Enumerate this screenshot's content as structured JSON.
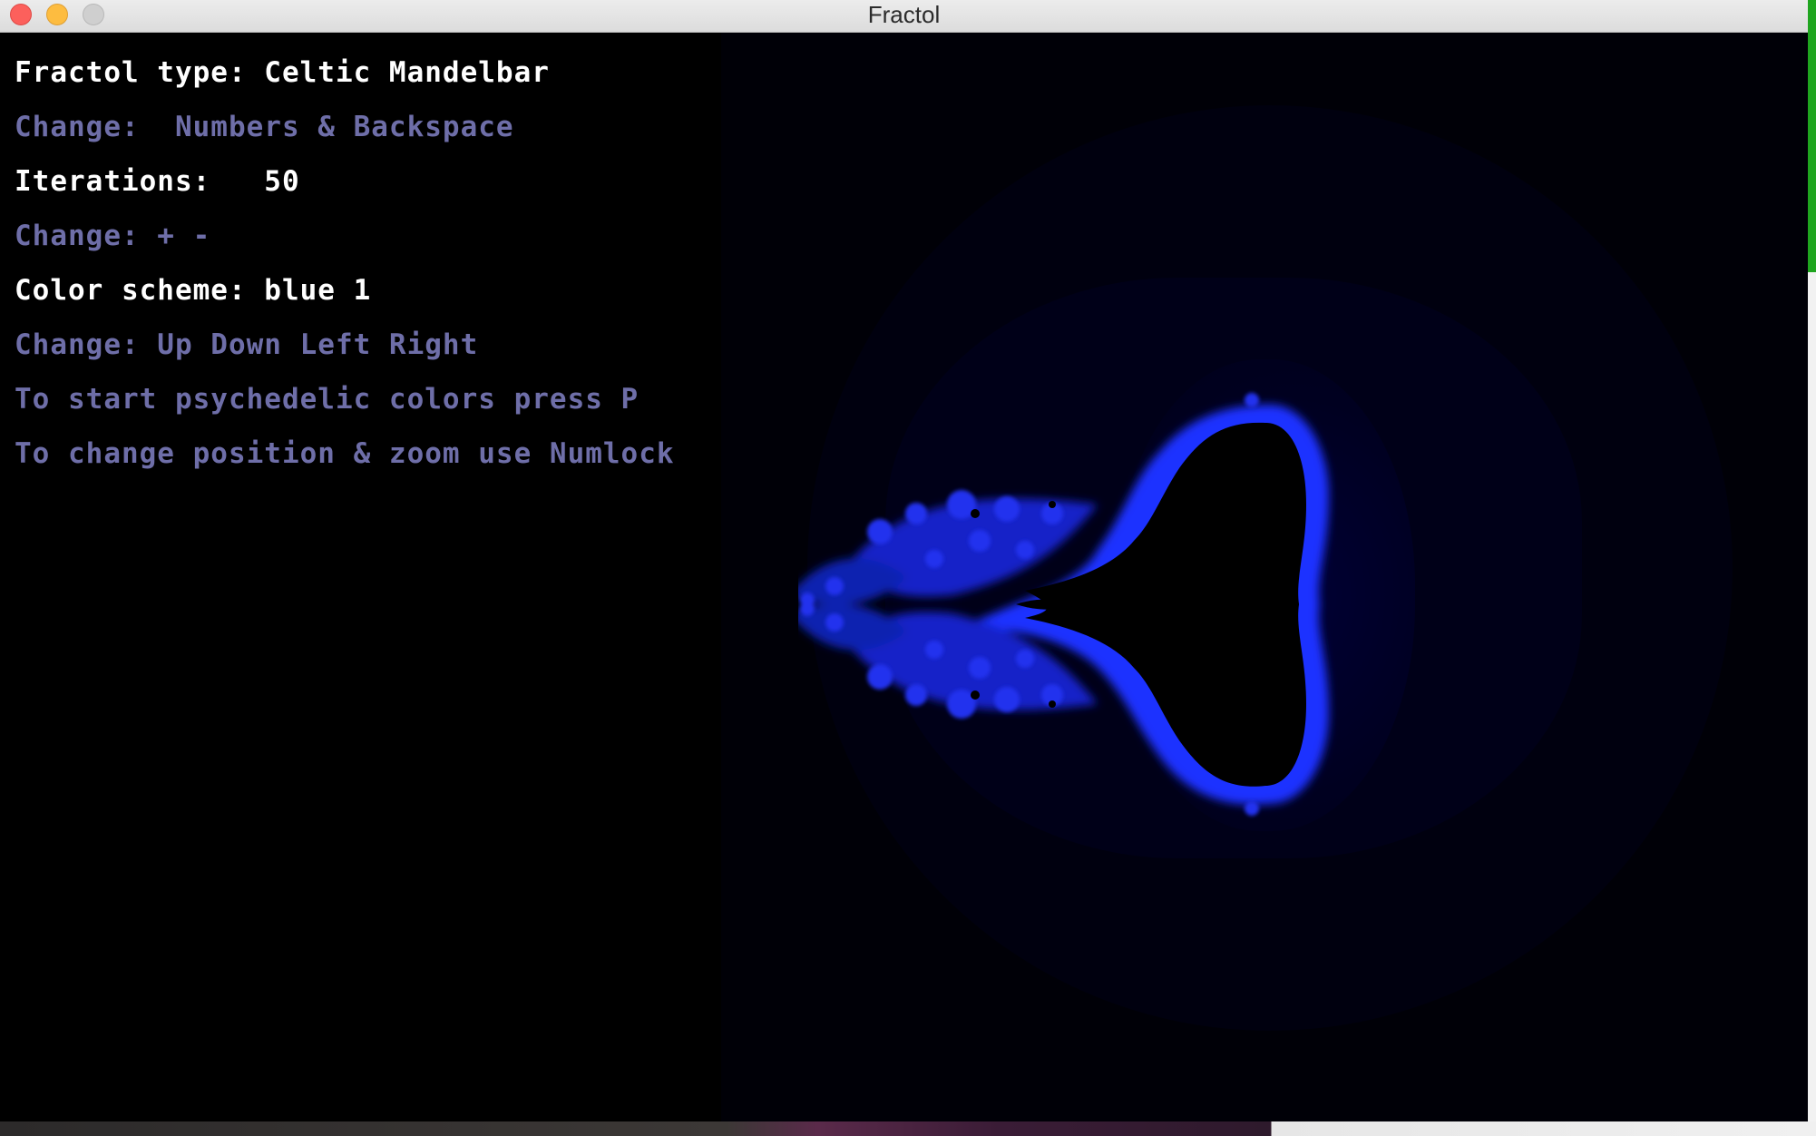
{
  "window": {
    "title": "Fractol"
  },
  "overlay": {
    "lines": [
      {
        "text": "Fractol type: Celtic Mandelbar",
        "style": "white"
      },
      {
        "text": "Change:  Numbers & Backspace",
        "style": "hint"
      },
      {
        "text": "Iterations:   50",
        "style": "white"
      },
      {
        "text": "Change: + -",
        "style": "hint"
      },
      {
        "text": "Color scheme: blue 1",
        "style": "white"
      },
      {
        "text": "Change: Up Down Left Right",
        "style": "hint"
      },
      {
        "text": "To start psychedelic colors press P",
        "style": "hint"
      },
      {
        "text": "To change position & zoom use Numlock",
        "style": "hint"
      }
    ]
  },
  "colors": {
    "info_text": "#ffffff",
    "hint_text": "#6e6ea8",
    "fractal_edge": "#1a2cff",
    "background": "#000000"
  }
}
